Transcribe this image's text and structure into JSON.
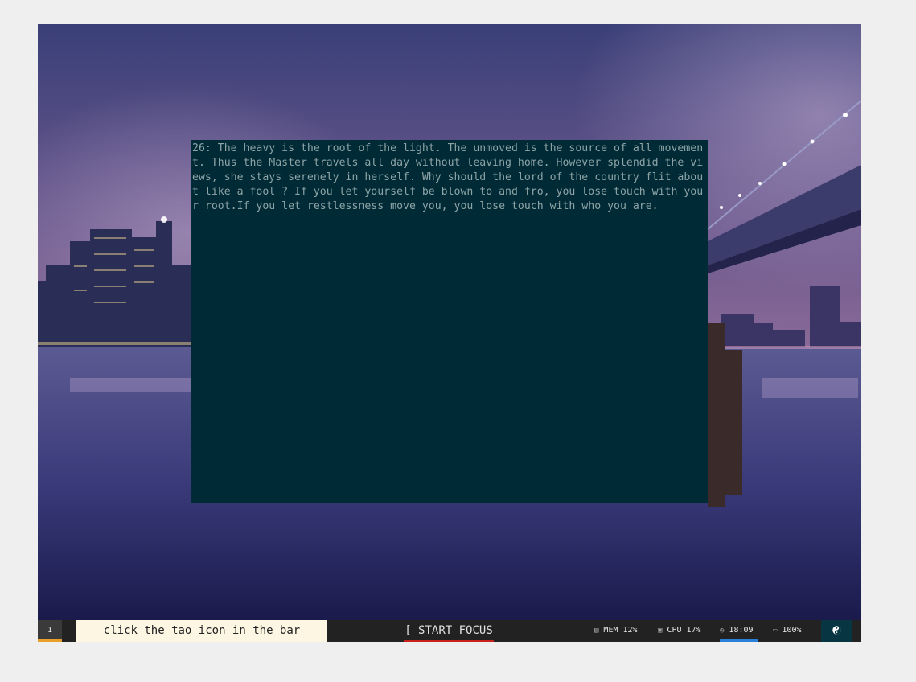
{
  "terminal": {
    "text": "26: The heavy is the root of the light. The unmoved is the source of all movement. Thus the Master travels all day without leaving home. However splendid the views, she stays serenely in herself. Why should the lord of the country flit about like a fool ? If you let yourself be blown to and fro, you lose touch with your root.If you let restlessness move you, you lose touch with who you are."
  },
  "bar": {
    "workspace": "1",
    "hint": "click the tao icon in the bar",
    "focus_button": "[ START FOCUS ]",
    "mem": {
      "icon": "memory-icon",
      "label": "MEM 12%"
    },
    "cpu": {
      "icon": "cpu-icon",
      "label": "CPU 17%"
    },
    "clock": {
      "icon": "clock-icon",
      "label": "18:09"
    },
    "battery": {
      "icon": "battery-icon",
      "label": "100%"
    },
    "tao_icon": "yin-yang-icon"
  },
  "colors": {
    "terminal_bg": "#002b36",
    "terminal_fg": "#8da3a6",
    "bar_bg": "#222222",
    "hint_bg": "#fdf6e3",
    "workspace_accent": "#e8a028",
    "focus_accent": "#c8201a",
    "clock_accent": "#2a7fd8",
    "tao_bg": "#073642"
  }
}
